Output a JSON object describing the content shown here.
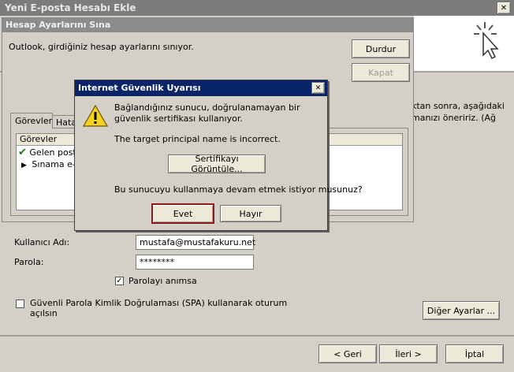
{
  "main_window": {
    "title": "Yeni E-posta Hesabı Ekle",
    "close_glyph": "✕",
    "right_text_line1": "ktan sonra, aşağıdaki",
    "right_text_line2": "manızı öneririz. (Ağ",
    "username_label": "Kullanıcı Adı:",
    "username_value": "mustafa@mustafakuru.net",
    "password_label": "Parola:",
    "password_value": "********",
    "remember_label": "Parolayı anımsa",
    "spa_label_line1": "Güvenli Parola Kimlik Doğrulaması (SPA) kullanarak oturum",
    "spa_label_line2": "açılsın",
    "more_settings_label": "Diğer Ayarlar ...",
    "back_label": "< Geri",
    "next_label": "İleri >",
    "cancel_label": "İptal"
  },
  "test_dialog": {
    "title": "Hesap Ayarlarını Sına",
    "message": "Outlook, girdiğiniz hesap ayarlarını sınıyor.",
    "stop_label": "Durdur",
    "close_label": "Kapat",
    "tabs": [
      "Görevler",
      "Hata"
    ],
    "list_header": "Görevler",
    "tasks": [
      "Gelen post",
      "Sınama e-p"
    ]
  },
  "alert": {
    "title": "Internet Güvenlik Uyarısı",
    "close_glyph": "✕",
    "line1": "Bağlandığınız sunucu, doğrulanamayan bir",
    "line2": "güvenlik sertifikası kullanıyor.",
    "line3": "The target principal name is incorrect.",
    "view_cert_label": "Sertifikayı Görüntüle...",
    "question": "Bu sunucuyu kullanmaya devam etmek istiyor musunuz?",
    "yes_label": "Evet",
    "no_label": "Hayır"
  },
  "colors": {
    "titlebar": "#0a246a",
    "inactive_title": "#8a8a8a",
    "default_button_border": "#8b1a1a"
  }
}
